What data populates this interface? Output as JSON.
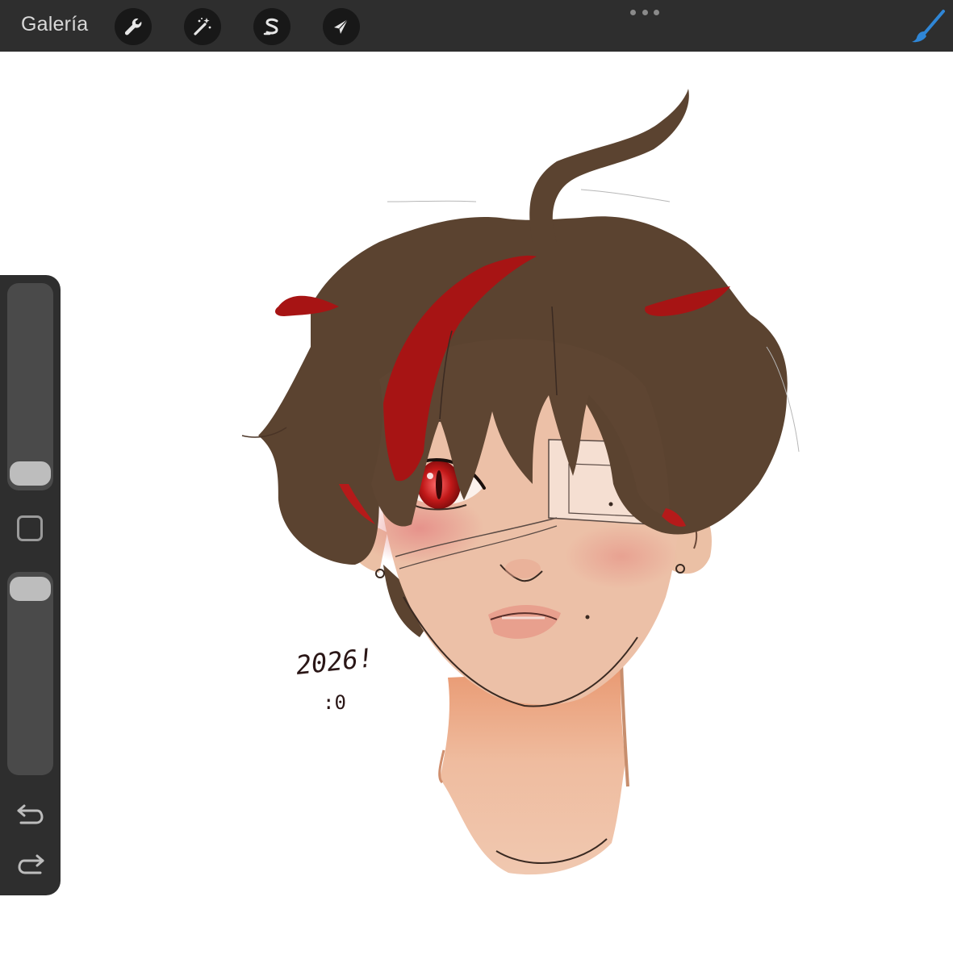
{
  "app": {
    "gallery_label": "Galería"
  },
  "toolbar": {
    "tools": [
      {
        "name": "wrench-icon"
      },
      {
        "name": "magic-wand-icon"
      },
      {
        "name": "selection-s-icon"
      },
      {
        "name": "transform-arrow-icon"
      }
    ],
    "brush_color": "#2f86d6"
  },
  "artwork": {
    "signature_text": "2026!",
    "face_text": ":0"
  },
  "sidebar": {
    "brush_size_level": 0.0,
    "opacity_level": 1.0
  },
  "colors": {
    "bar": "#2e2e2e",
    "hair": "#5b4330",
    "hair_red": "#a71414",
    "skin": "#ecc0a7",
    "eye": "#c01818"
  }
}
